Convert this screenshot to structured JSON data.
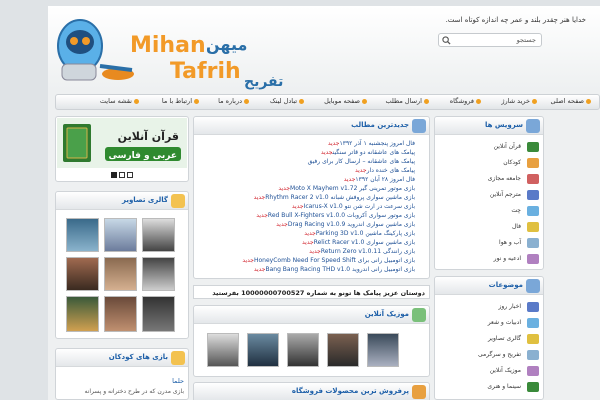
{
  "header": {
    "tagline": "خدایا هنر چقدر بلند و عمر چه اندازه کوتاه است.",
    "search_placeholder": "جستجو",
    "logo": {
      "latin_top": "Mihan",
      "latin_bottom": "Tafrih",
      "persian_top": "میهن",
      "persian_bottom": "تفریح"
    }
  },
  "nav": {
    "items": [
      "صفحه اصلی",
      "خرید شارژ",
      "فروشگاه",
      "ارسال مطلب",
      "صفحه موبایل",
      "تبادل لینک",
      "درباره ما",
      "ارتباط با ما",
      "نقشه سایت"
    ]
  },
  "left": {
    "quran_banner": {
      "line1": "قرآن آنلاین",
      "line2": "عربی و فارسی"
    },
    "gallery_title": "گالری تصاویر",
    "kids_title": "بازی های کودکان",
    "kids_link": "حلما",
    "kids_text": "بازی مدرن که در طرح دخترانه و پسرانه"
  },
  "center": {
    "latest_title": "جدیدترین مطالب",
    "latest_items": [
      {
        "text": "فال امروز پنجشنبه ۱ آذر ۱۳۹۲",
        "new": "جدید"
      },
      {
        "text": "پیامک های عاشقانه دو قاتر سنگین",
        "new": "جدید"
      },
      {
        "text": "پیامک های عاشقانه – ارسال کار برای رفیق",
        "new": ""
      },
      {
        "text": "پیامک های خنده دار",
        "new": "جدید"
      },
      {
        "text": "فال امروز ۲۸ آبان ۱۳۹۲",
        "new": "جدید"
      },
      {
        "text": "بازی موتور تمرینی گیر Moto X Mayhem v1.72",
        "new": "جدید"
      },
      {
        "text": "بازی ماشین سواری پروفش شبانه Rhythm Racer 2 v1.0",
        "new": "جدید"
      },
      {
        "text": "بازی سرعت در ارت شن نتو Icarus-X v1.0",
        "new": "جدید"
      },
      {
        "text": "بازی موتور سواری آکروبات Red Bull X-Fighters v1.0.0",
        "new": "جدید"
      },
      {
        "text": "بازی ماشین سواری اندروید Drag Racing v1.0.9",
        "new": "جدید"
      },
      {
        "text": "بازی پارکینگ ماشین Parking 3D v1.0",
        "new": "جدید"
      },
      {
        "text": "بازی ماشین سواری Relict Racer v1.0",
        "new": "جدید"
      },
      {
        "text": "بازی رانندگی Return Zero v1.0.11",
        "new": "جدید"
      },
      {
        "text": "بازی اتومبیل رانی برای HoneyComb Need For Speed Shift",
        "new": "جدید"
      },
      {
        "text": "بازی اتومبیل رانی اندروید Bang Bang Racing THD v1.0",
        "new": "جدید"
      }
    ],
    "marquee": "دوستان عزیز پیامک ها تونو به شماره 10000000700527 بفرستید",
    "music_title": "موزیک آنلاین",
    "shop_title": "پرفروش ترین محصولات فروشگاه"
  },
  "right": {
    "services_title": "سرویس ها",
    "services": [
      "قرآن آنلاین",
      "کودکان",
      "جامعه مجازی",
      "مترجم آنلاین",
      "چت",
      "فال",
      "آب و هوا",
      "ادعیه و نور"
    ],
    "topics_title": "موضوعات",
    "topics": [
      "اخبار روز",
      "ادبیات و شعر",
      "گالری تصاویر",
      "تفریح و سرگرمی",
      "موزیک آنلاین",
      "سینما و هنری"
    ]
  },
  "colors": {
    "accent": "#1d5fa8",
    "new_badge": "#d0202a",
    "nav_dot": "#f0a020"
  }
}
